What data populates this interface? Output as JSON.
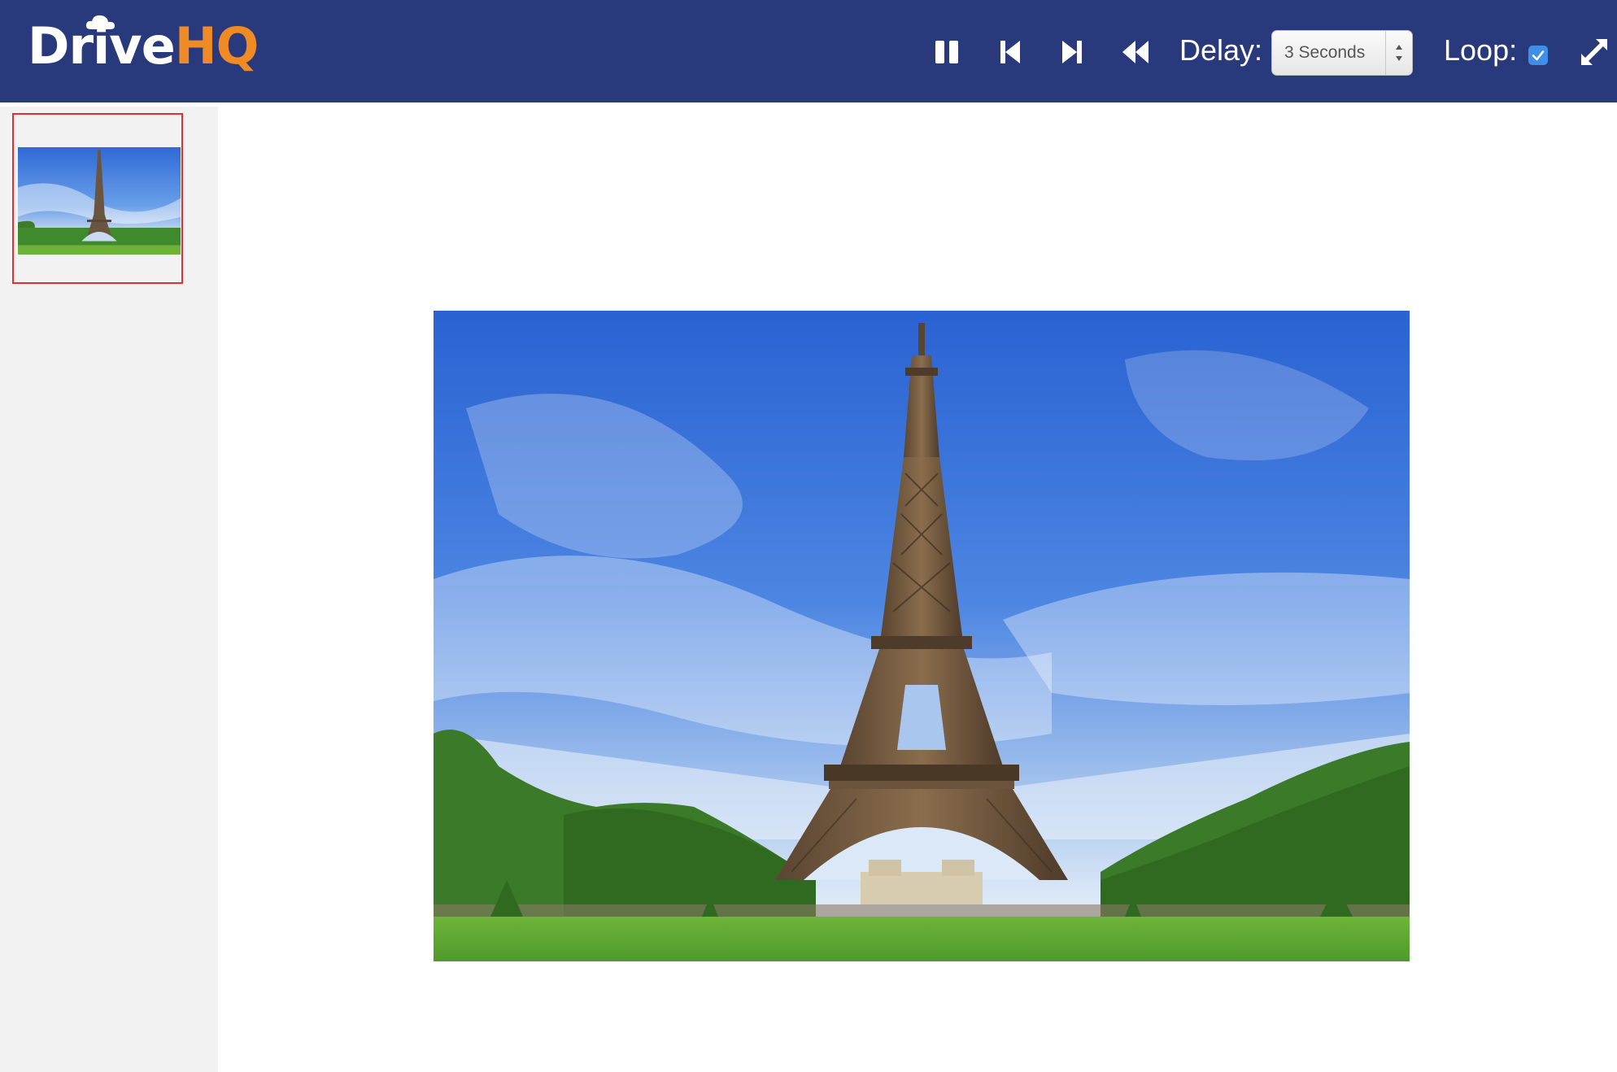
{
  "header": {
    "logo": {
      "part1": "Drive",
      "part2": "HQ"
    },
    "controls": {
      "pause": "pause-icon",
      "first": "skip-first-icon",
      "next": "skip-next-icon",
      "rewind": "rewind-icon",
      "delay_label": "Delay:",
      "delay_value": "3 Seconds",
      "loop_label": "Loop:",
      "loop_checked": true,
      "fullscreen": "fullscreen-icon"
    }
  },
  "sidebar": {
    "thumbnails": [
      {
        "selected": true
      }
    ]
  },
  "colors": {
    "header_bg": "#283a7c",
    "logo_accent": "#f08a24",
    "selection_border": "#e03030",
    "sidebar_bg": "#f2f2f2",
    "checkbox": "#3f8ee8"
  }
}
